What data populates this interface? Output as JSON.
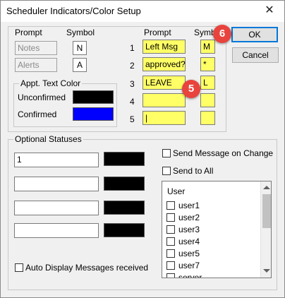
{
  "window": {
    "title": "Scheduler Indicators/Color Setup",
    "close_glyph": "✕"
  },
  "left_panel": {
    "prompt_header": "Prompt",
    "symbol_header": "Symbol",
    "rows": [
      {
        "prompt": "Notes",
        "symbol": "N"
      },
      {
        "prompt": "Alerts",
        "symbol": "A"
      }
    ],
    "appt_color": {
      "caption": "Appt. Text Color",
      "unconfirmed_label": "Unconfirmed",
      "confirmed_label": "Confirmed",
      "unconfirmed_color": "#000000",
      "confirmed_color": "#0000ff"
    }
  },
  "custom_prompts": {
    "prompt_header": "Prompt",
    "symbol_header": "Symb",
    "rows": [
      {
        "num": "1",
        "prompt": "Left Msg",
        "symbol": "M"
      },
      {
        "num": "2",
        "prompt": "approved?",
        "symbol": "*"
      },
      {
        "num": "3",
        "prompt": "LEAVE",
        "symbol": "L"
      },
      {
        "num": "4",
        "prompt": "",
        "symbol": ""
      },
      {
        "num": "5",
        "prompt": "|",
        "symbol": ""
      }
    ],
    "input_bg": "#ffff66"
  },
  "buttons": {
    "ok": "OK",
    "cancel": "Cancel"
  },
  "optional_statuses": {
    "caption": "Optional Statuses",
    "rows": [
      {
        "value": "1",
        "color": "#000000"
      },
      {
        "value": "",
        "color": "#000000"
      },
      {
        "value": "",
        "color": "#000000"
      },
      {
        "value": "",
        "color": "#000000"
      }
    ],
    "send_message_label": "Send Message on Change",
    "send_to_all_label": "Send to All",
    "auto_display_label": "Auto Display Messages received",
    "user_list": {
      "header": "User",
      "users": [
        "user1",
        "user2",
        "user3",
        "user4",
        "user5",
        "user7",
        "server"
      ]
    }
  },
  "callouts": {
    "ok_step": "6",
    "leave_step": "5",
    "color": "#e8433d"
  }
}
